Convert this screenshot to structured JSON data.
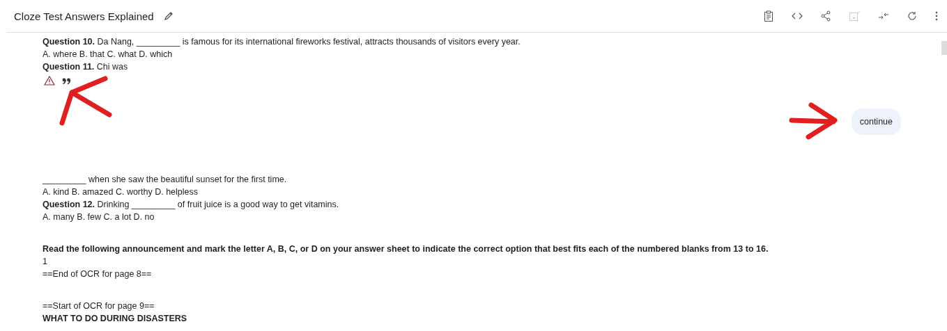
{
  "header": {
    "title": "Cloze Test Answers Explained"
  },
  "toolbar": [
    {
      "kind": "clipboard",
      "disabled": false
    },
    {
      "kind": "code",
      "disabled": false
    },
    {
      "kind": "share",
      "disabled": false
    },
    {
      "kind": "save",
      "disabled": true
    },
    {
      "kind": "collapse",
      "disabled": false
    },
    {
      "kind": "refresh",
      "disabled": false
    },
    {
      "kind": "more",
      "disabled": false
    }
  ],
  "response": {
    "lines": [
      {
        "kind": "text",
        "text": "**Question 10.** Da Nang, _________ is famous for its international fireworks festival, attracts thousands of visitors every year.",
        "space_before": false
      },
      {
        "kind": "text",
        "text": "A. where B. that C. what D. which",
        "space_before": false
      },
      {
        "kind": "text",
        "text": "**Question 11.** Chi was",
        "space_before": false
      }
    ],
    "actions": [
      {
        "kind": "warning"
      },
      {
        "kind": "quote"
      }
    ]
  },
  "user_message": {
    "text": "continue"
  },
  "response_continued": {
    "lines": [
      {
        "kind": "text",
        "text": "_________ when she saw the beautiful sunset for the first time.",
        "space_before": false
      },
      {
        "kind": "text",
        "text": "A. kind B. amazed C. worthy D. helpless",
        "space_before": false
      },
      {
        "kind": "text",
        "text": "**Question 12.** Drinking _________ of fruit juice is a good way to get vitamins.",
        "space_before": false
      },
      {
        "kind": "text",
        "text": "A. many B. few C. a lot D. no",
        "space_before": false
      },
      {
        "kind": "bold",
        "text": "Read the following announcement and mark the letter A, B, C, or D on your answer sheet to indicate the correct option that best fits each of the numbered blanks from 13 to 16.",
        "space_before": true
      },
      {
        "kind": "text",
        "text": "1",
        "space_before": false
      },
      {
        "kind": "text",
        "text": "==End of OCR for page 8==",
        "space_before": false
      },
      {
        "kind": "text",
        "text": "==Start of OCR for page 9==",
        "space_before": true
      },
      {
        "kind": "bold",
        "text": "WHAT TO DO DURING DISASTERS",
        "space_before": false
      }
    ]
  }
}
